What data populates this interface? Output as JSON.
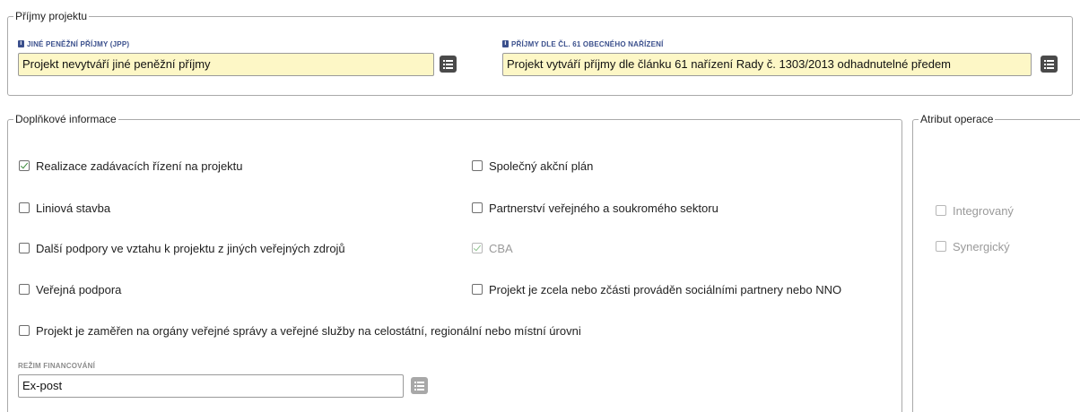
{
  "income": {
    "legend": "Příjmy projektu",
    "jpp": {
      "label": "JINÉ PENĚŽNÍ PŘÍJMY (JPP)",
      "value": "Projekt nevytváří jiné peněžní příjmy"
    },
    "art61": {
      "label": "PŘÍJMY DLE ČL. 61 OBECNÉHO NAŘÍZENÍ",
      "value": "Projekt vytváří příjmy dle článku 61 nařízení Rady č. 1303/2013 odhadnutelné předem"
    }
  },
  "additional": {
    "legend": "Doplňkové informace",
    "checkboxes": [
      {
        "label": "Realizace zadávacích řízení na projektu",
        "checked": true,
        "disabled": false
      },
      {
        "label": "Společný akční plán",
        "checked": false,
        "disabled": false
      },
      {
        "label": "Liniová stavba",
        "checked": false,
        "disabled": false
      },
      {
        "label": "Partnerství veřejného a soukromého sektoru",
        "checked": false,
        "disabled": false
      },
      {
        "label": "Další podpory ve vztahu k projektu z jiných veřejných zdrojů",
        "checked": false,
        "disabled": false
      },
      {
        "label": "CBA",
        "checked": true,
        "disabled": true
      },
      {
        "label": "Veřejná podpora",
        "checked": false,
        "disabled": false
      },
      {
        "label": "Projekt je zcela nebo zčásti prováděn sociálními partnery nebo NNO",
        "checked": false,
        "disabled": false
      },
      {
        "label": "Projekt je zaměřen na orgány veřejné správy a veřejné služby na celostátní, regionální nebo místní úrovni",
        "checked": false,
        "disabled": false
      }
    ],
    "financing": {
      "label": "REŽIM FINANCOVÁNÍ",
      "value": "Ex-post"
    }
  },
  "attribute": {
    "legend": "Atribut operace",
    "checkboxes": [
      {
        "label": "Integrovaný",
        "checked": false,
        "disabled": true
      },
      {
        "label": "Synergický",
        "checked": false,
        "disabled": true
      }
    ]
  },
  "icons": {
    "info": "info-icon",
    "list": "list-icon",
    "check": "checkbox-icon"
  },
  "colors": {
    "input_highlight": "#fdf7c6",
    "label_blue": "#3a4f8c",
    "checkmark_green": "#3a8a3a"
  }
}
